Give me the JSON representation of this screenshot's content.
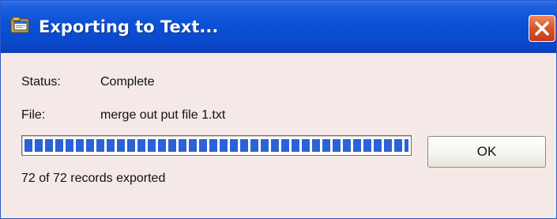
{
  "window": {
    "title": "Exporting to Text..."
  },
  "status": {
    "label": "Status:",
    "value": "Complete"
  },
  "file": {
    "label": "File:",
    "value": "merge out put file 1.txt"
  },
  "progress": {
    "fraction": 1.0,
    "records_text": "72 of 72 records exported"
  },
  "buttons": {
    "ok_label": "OK",
    "close_icon": "close-icon"
  },
  "colors": {
    "titlebar": "#0a4bd0",
    "progress_fill": "#2b62d6",
    "close_button": "#d9532b",
    "dialog_background": "#f4e9e6"
  }
}
